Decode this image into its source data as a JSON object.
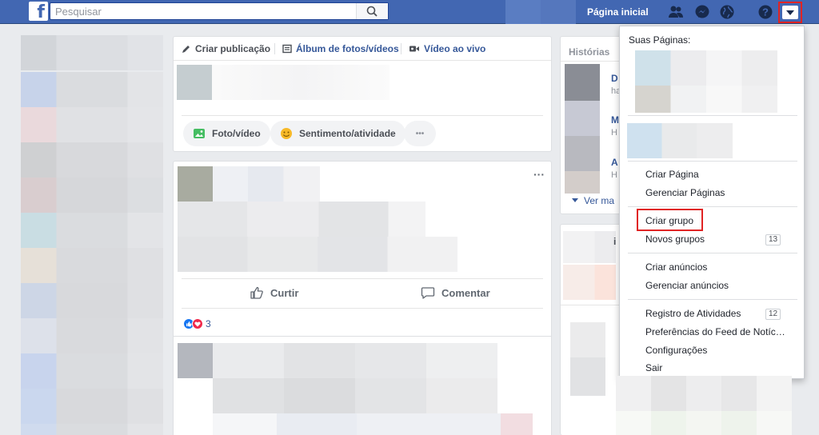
{
  "topbar": {
    "logo": "f",
    "search_placeholder": "Pesquisar",
    "home_label": "Página inicial",
    "icons": [
      "search-icon",
      "friends-icon",
      "messenger-icon",
      "globe-icon",
      "help-icon",
      "dropdown-arrow-icon"
    ]
  },
  "composer": {
    "tabs": [
      "Criar publicação",
      "Álbum de fotos/vídeos",
      "Vídeo ao vivo"
    ],
    "buttons": [
      "Foto/vídeo",
      "Sentimento/atividade",
      "•••"
    ]
  },
  "post": {
    "more": "···",
    "like_label": "Curtir",
    "comment_label": "Comentar",
    "reaction_count": "3"
  },
  "stories": {
    "title": "Histórias",
    "initials": [
      "D",
      "M",
      "A"
    ],
    "subs": [
      "ha",
      "H",
      "H"
    ],
    "see_more": "Ver ma"
  },
  "right_col": {
    "partial_text": "i"
  },
  "menu": {
    "header": "Suas Páginas:",
    "groups": [
      [
        "Criar Página",
        "Gerenciar Páginas"
      ],
      [
        "Criar grupo",
        "Novos grupos"
      ],
      [
        "Criar anúncios",
        "Gerenciar anúncios"
      ],
      [
        "Registro de Atividades",
        "Preferências do Feed de Notíc…",
        "Configurações",
        "Sair"
      ]
    ],
    "badges": {
      "novos_grupos": "13",
      "registro": "12"
    },
    "highlighted": "Criar grupo"
  },
  "colors": {
    "brand": "#4267b2",
    "highlight_border": "#e02424",
    "link": "#365899"
  }
}
